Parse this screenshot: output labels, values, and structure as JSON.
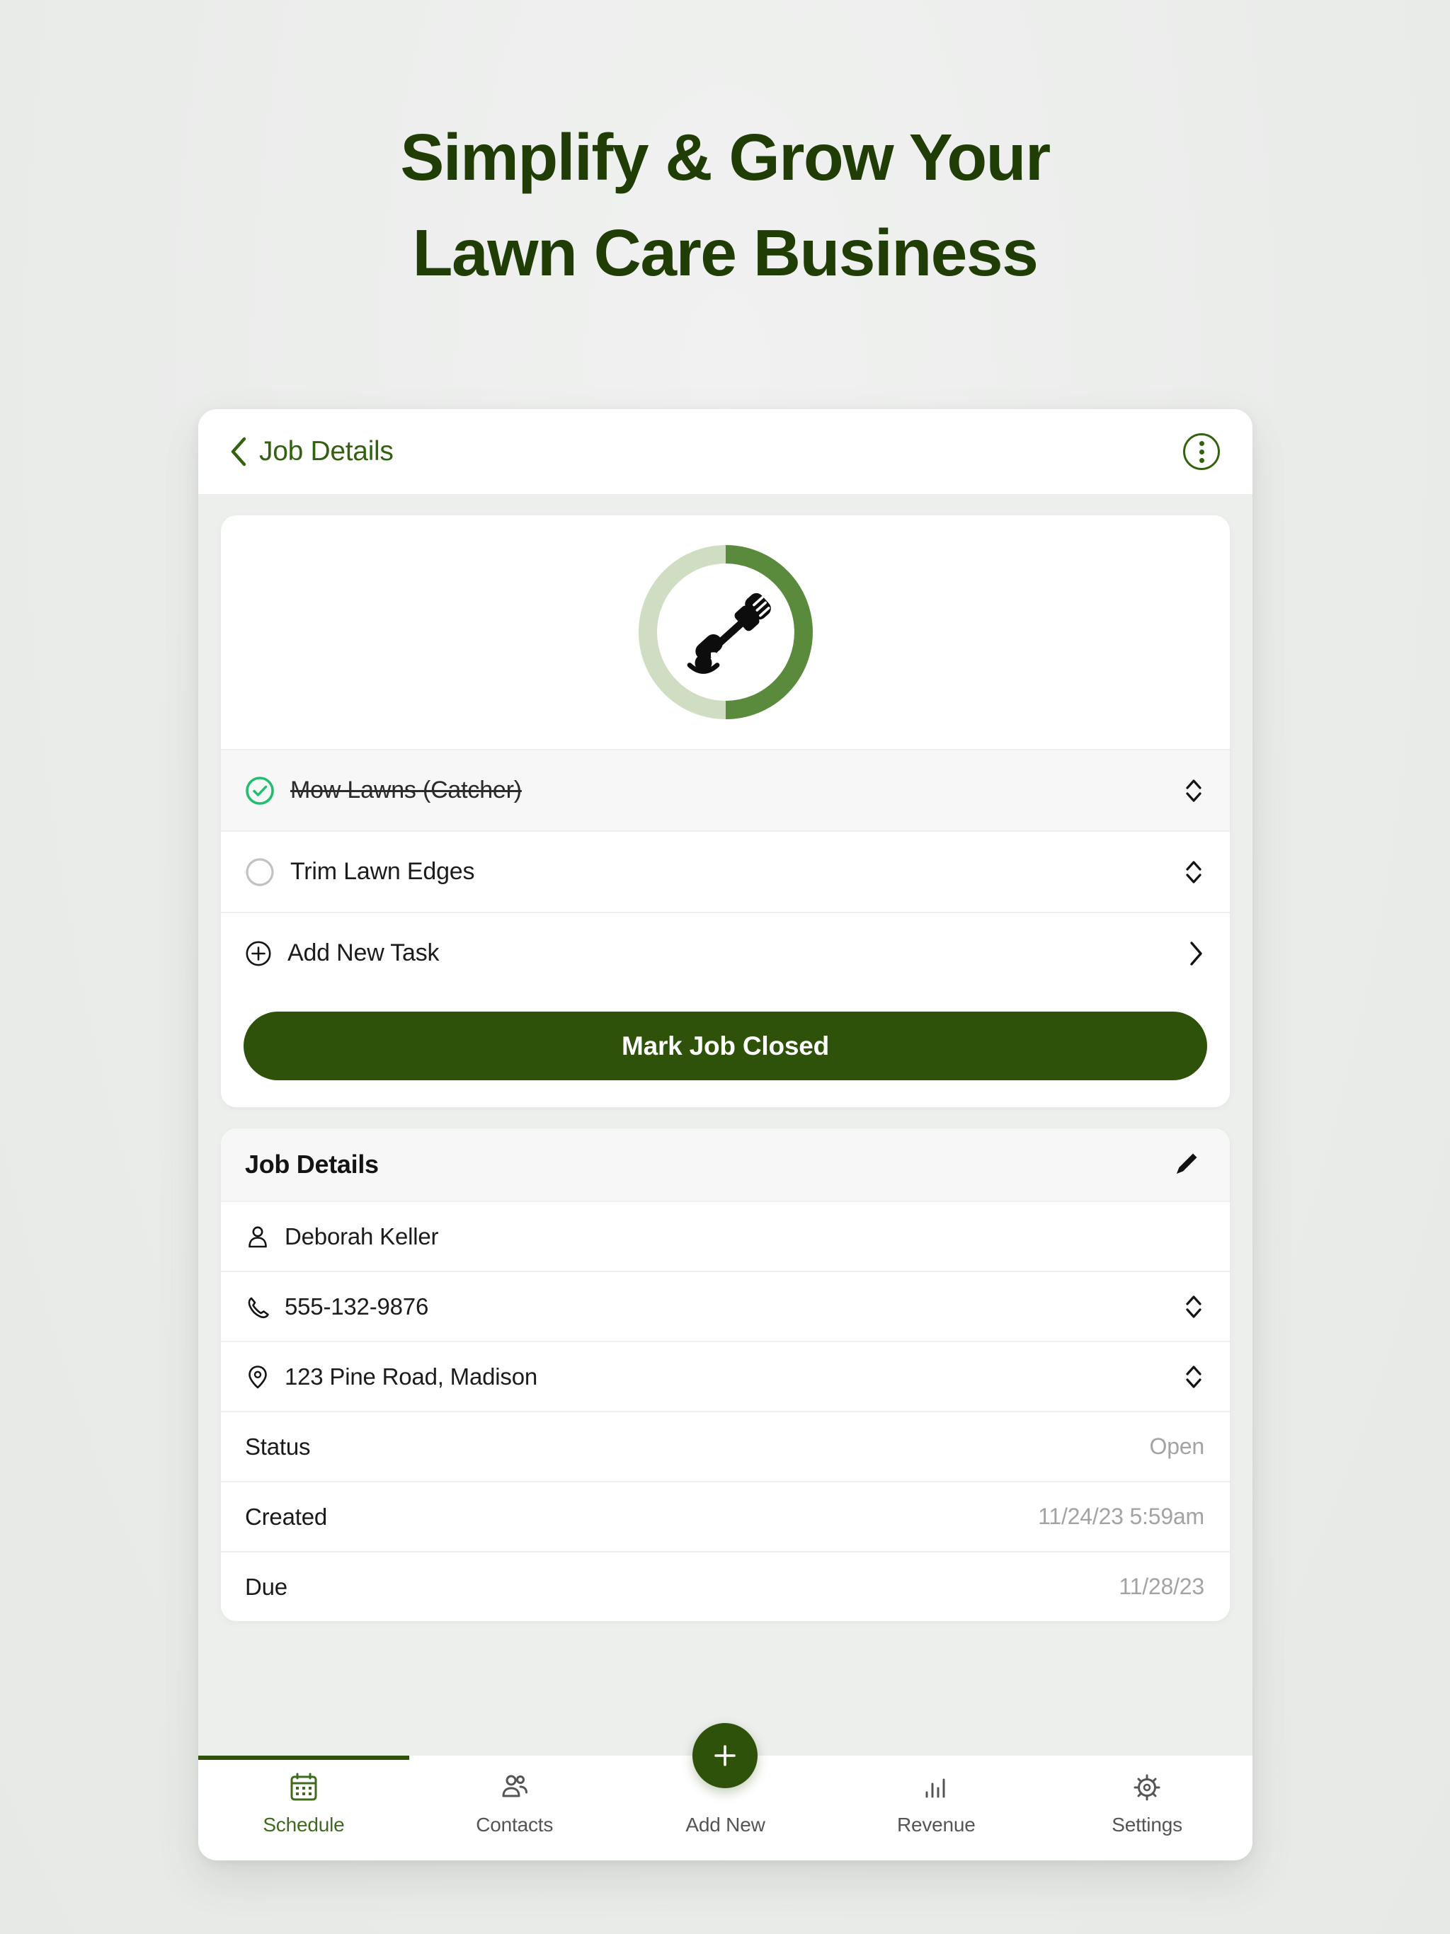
{
  "marketing": {
    "headline_line1": "Simplify & Grow Your",
    "headline_line2": "Lawn Care Business",
    "headline_color": "#1f3d05"
  },
  "app_header": {
    "title": "Job Details",
    "back_icon": "chevron-left-icon",
    "menu_icon": "kebab-menu-icon",
    "accent_color": "#33620f"
  },
  "progress": {
    "percent": 50,
    "track_color": "#cfdec2",
    "fill_color": "#5a8a3c",
    "icon": "string-trimmer-icon"
  },
  "tasks": {
    "items": [
      {
        "label": "Mow Lawns (Catcher)",
        "done": true,
        "handle_icon": "sort-handle-icon"
      },
      {
        "label": "Trim Lawn Edges",
        "done": false,
        "handle_icon": "sort-handle-icon"
      }
    ],
    "add_task_label": "Add New Task",
    "add_task_icon": "plus-circle-icon",
    "add_task_chevron": "chevron-right-icon",
    "check_color": "#1fbf6e"
  },
  "primary_action": {
    "label": "Mark Job Closed",
    "bg_color": "#2e5209",
    "text_color": "#ffffff"
  },
  "details": {
    "section_title": "Job Details",
    "edit_icon": "pencil-icon",
    "contact_rows": [
      {
        "icon": "person-icon",
        "text": "Deborah Keller",
        "has_handle": false
      },
      {
        "icon": "phone-icon",
        "text": "555-132-9876",
        "has_handle": true
      },
      {
        "icon": "location-pin-icon",
        "text": "123 Pine Road, Madison",
        "has_handle": true
      }
    ],
    "meta_rows": [
      {
        "key": "Status",
        "value": "Open"
      },
      {
        "key": "Created",
        "value": "11/24/23 5:59am"
      },
      {
        "key": "Due",
        "value": "11/28/23"
      }
    ]
  },
  "bottom_nav": {
    "active_index": 0,
    "active_color": "#3e6b1e",
    "items": [
      {
        "label": "Schedule",
        "icon": "calendar-icon"
      },
      {
        "label": "Contacts",
        "icon": "people-icon"
      },
      {
        "label": "Add New",
        "icon": "plus-icon"
      },
      {
        "label": "Revenue",
        "icon": "bar-chart-icon"
      },
      {
        "label": "Settings",
        "icon": "gear-icon"
      }
    ]
  }
}
